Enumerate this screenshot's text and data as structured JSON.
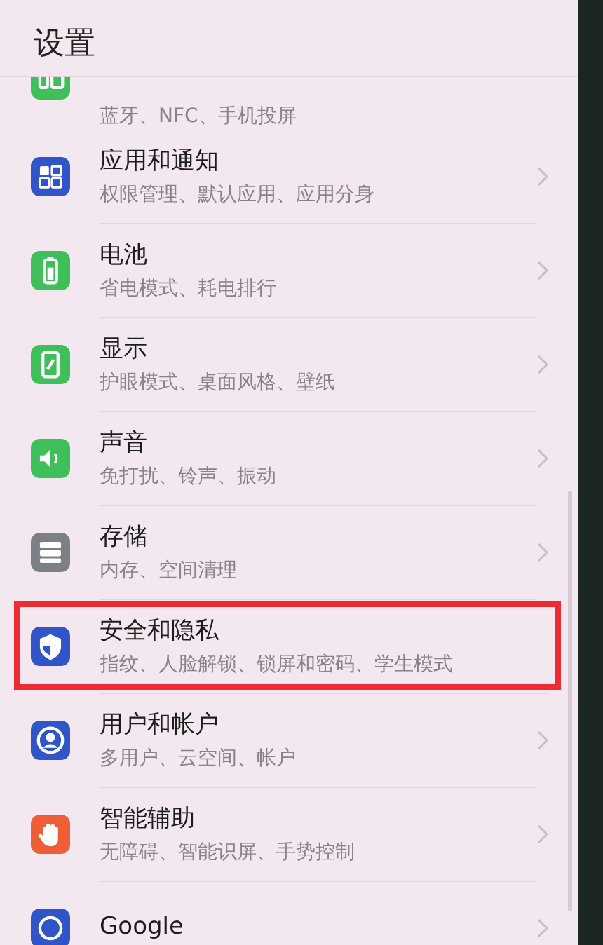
{
  "title": "设置",
  "items": [
    {
      "kind": "connect",
      "color": "#3fbf5a",
      "subtitle": "蓝牙、NFC、手机投屏",
      "selected": false
    },
    {
      "kind": "apps",
      "color": "#2f55c8",
      "title": "应用和通知",
      "subtitle": "权限管理、默认应用、应用分身",
      "selected": false
    },
    {
      "kind": "battery",
      "color": "#3fbf5a",
      "title": "电池",
      "subtitle": "省电模式、耗电排行",
      "selected": false
    },
    {
      "kind": "display",
      "color": "#3fbf5a",
      "title": "显示",
      "subtitle": "护眼模式、桌面风格、壁纸",
      "selected": false
    },
    {
      "kind": "sound",
      "color": "#3fbf5a",
      "title": "声音",
      "subtitle": "免打扰、铃声、振动",
      "selected": false
    },
    {
      "kind": "storage",
      "color": "#7d7f86",
      "title": "存储",
      "subtitle": "内存、空间清理",
      "selected": false
    },
    {
      "kind": "security",
      "color": "#2f55c8",
      "title": "安全和隐私",
      "subtitle": "指纹、人脸解锁、锁屏和密码、学生模式",
      "selected": true
    },
    {
      "kind": "user",
      "color": "#2f55c8",
      "title": "用户和帐户",
      "subtitle": "多用户、云空间、帐户",
      "selected": false
    },
    {
      "kind": "assist",
      "color": "#ee5f38",
      "title": "智能辅助",
      "subtitle": "无障碍、智能识屏、手势控制",
      "selected": false
    },
    {
      "kind": "google",
      "color": "#2f55c8",
      "title": "Google",
      "selected": false
    }
  ]
}
